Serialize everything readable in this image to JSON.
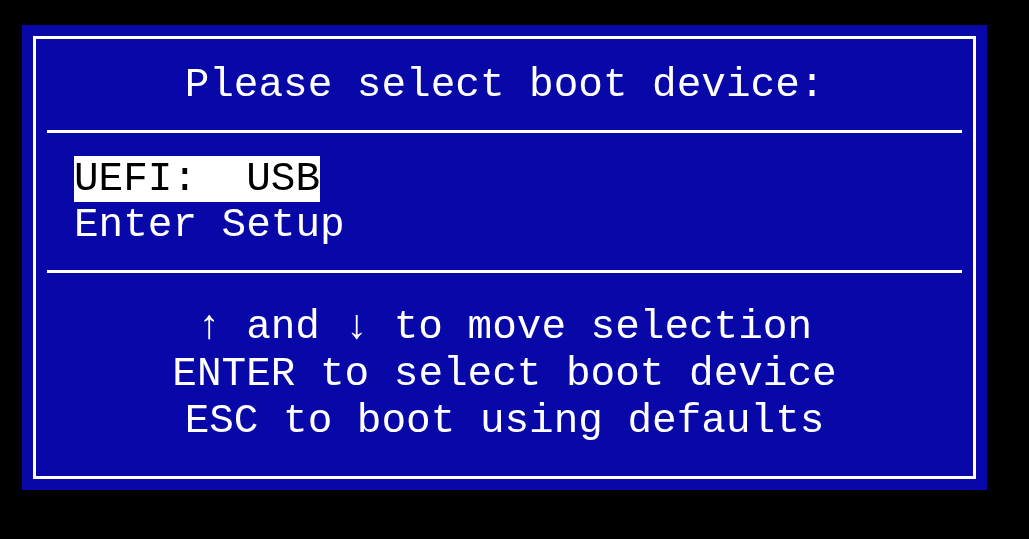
{
  "title": "Please select boot device:",
  "items": [
    {
      "label": "UEFI:  USB",
      "selected": true
    },
    {
      "label": "Enter Setup",
      "selected": false
    }
  ],
  "help": [
    "↑ and ↓ to move selection",
    "ENTER to select boot device",
    "ESC to boot using defaults"
  ]
}
